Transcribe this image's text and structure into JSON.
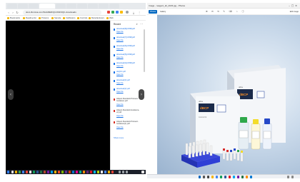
{
  "left_window": {
    "url": "docs.illumina.com/SHARED/QC/2023/QC-downloads",
    "bookmarks": [
      "Bookmarks",
      "Reading list",
      "Proteins",
      "Sample",
      "Calibrators",
      "Controls",
      "Manufacturers",
      "Web"
    ],
    "downloads_panel": {
      "title": "Recent",
      "items": [
        {
          "name": "download(8)(IVDR)pdf",
          "action": "Open file"
        },
        {
          "name": "download(7)(IVDR)pdf",
          "action": "Open file"
        },
        {
          "name": "download(6)(IVDR)pdf",
          "action": "Open file"
        },
        {
          "name": "download(5)(IVDR)pdf",
          "action": "Open file"
        },
        {
          "name": "download(4)(IVDR)pdf",
          "action": "Open file"
        },
        {
          "name": "dsQCC.pdf",
          "action": "Open file"
        },
        {
          "name": "download(3).pdf",
          "action": "Open file"
        },
        {
          "name": "download(2).pdf",
          "action": "Open file"
        },
        {
          "name": "Aliquot-Standard-Protocol-Guidance.pdf",
          "action": "Open file"
        },
        {
          "name": "Aliquot-Standard-Guidance-v2.pdf",
          "action": "Open file"
        },
        {
          "name": "Aliquot-Standard-Protocol-Guidance(1).pdf",
          "action": "Open file"
        }
      ],
      "more": "Show more"
    }
  },
  "right_window": {
    "title": "Image - reagent_kit_2023.jpg - Photos",
    "app_button": "Photos",
    "gallery_label": "Gallery",
    "right_label": "Edit image",
    "product": {
      "box_brand": "ultra",
      "box_logo": "dBCP",
      "box_small_text": "Control Kit"
    }
  },
  "colors": {
    "accent": "#0067c0",
    "link": "#1a73e8",
    "pdf": "#d93025",
    "viewer_bg": "#000000",
    "tray": "#2f3fd6"
  }
}
